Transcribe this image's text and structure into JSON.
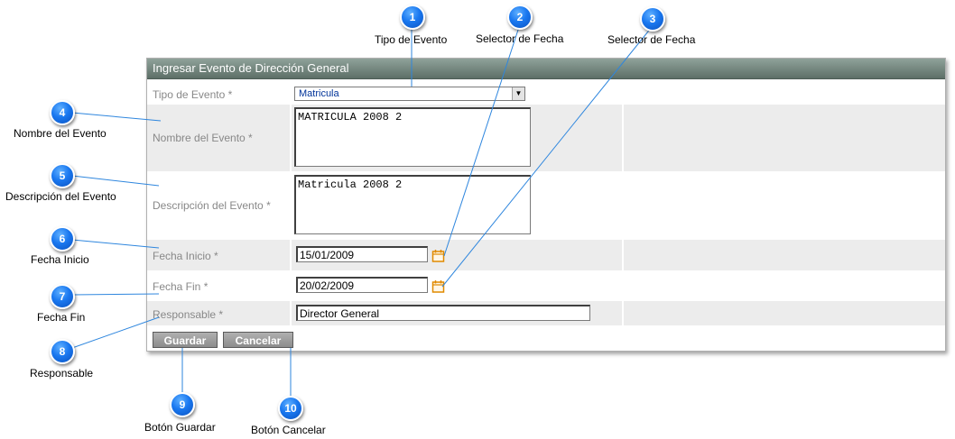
{
  "form": {
    "title": "Ingresar Evento de Dirección General",
    "tipo_evento": {
      "label": "Tipo de Evento *",
      "value": "Matricula"
    },
    "nombre_evento": {
      "label": "Nombre del Evento *",
      "value": "MATRICULA 2008 2"
    },
    "descripcion_evento": {
      "label": "Descripción del Evento *",
      "value": "Matricula 2008 2"
    },
    "fecha_inicio": {
      "label": "Fecha Inicio *",
      "value": "15/01/2009"
    },
    "fecha_fin": {
      "label": "Fecha Fin *",
      "value": "20/02/2009"
    },
    "responsable": {
      "label": "Responsable *",
      "value": "Director General"
    },
    "guardar_label": "Guardar",
    "cancelar_label": "Cancelar"
  },
  "callouts": [
    {
      "number": "1",
      "label": "Tipo de Evento"
    },
    {
      "number": "2",
      "label": "Selector de Fecha"
    },
    {
      "number": "3",
      "label": "Selector de Fecha"
    },
    {
      "number": "4",
      "label": "Nombre del Evento"
    },
    {
      "number": "5",
      "label": "Descripción del Evento"
    },
    {
      "number": "6",
      "label": "Fecha Inicio"
    },
    {
      "number": "7",
      "label": "Fecha Fin"
    },
    {
      "number": "8",
      "label": "Responsable"
    },
    {
      "number": "9",
      "label": "Botón Guardar"
    },
    {
      "number": "10",
      "label": "Botón Cancelar"
    }
  ],
  "icons": {
    "date_picker": "calendar-icon",
    "dropdown": "chevron-down-icon"
  },
  "colors": {
    "callout": "#1a78f0",
    "header": "#6f817a",
    "row_shade": "#ececec",
    "label_text": "#888888",
    "button": "#9a9a9a"
  }
}
